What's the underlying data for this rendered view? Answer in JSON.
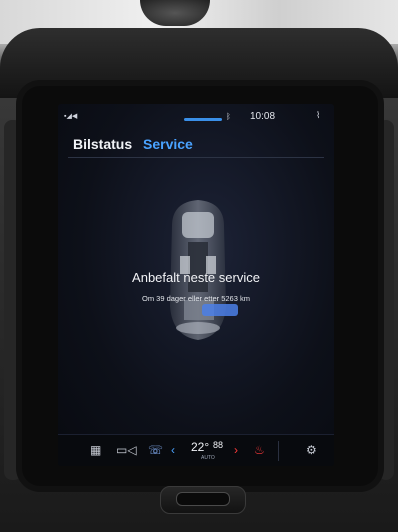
{
  "status": {
    "left_icons": "▪◢◀",
    "bluetooth": "ᛒ",
    "time": "10:08",
    "right_icon": "⌇"
  },
  "tabs": [
    {
      "label": "Bilstatus"
    },
    {
      "label": "Service"
    }
  ],
  "service": {
    "title": "Anbefalt neste service",
    "subtitle": "Om 39 dager eller etter 5263 km"
  },
  "bottom": {
    "grid_icon": "grid-icon",
    "camera_icon": "camera-icon",
    "phone_icon": "phone-icon",
    "left_arrow": "‹",
    "temp_main": "22°",
    "temp_small": "88",
    "auto": "AUTO",
    "right_arrow": "›",
    "gear_icon": "gear-icon"
  },
  "colors": {
    "accent": "#4aa3ff",
    "warning": "#ff3b3b",
    "screen_bg": "#0d1019"
  }
}
